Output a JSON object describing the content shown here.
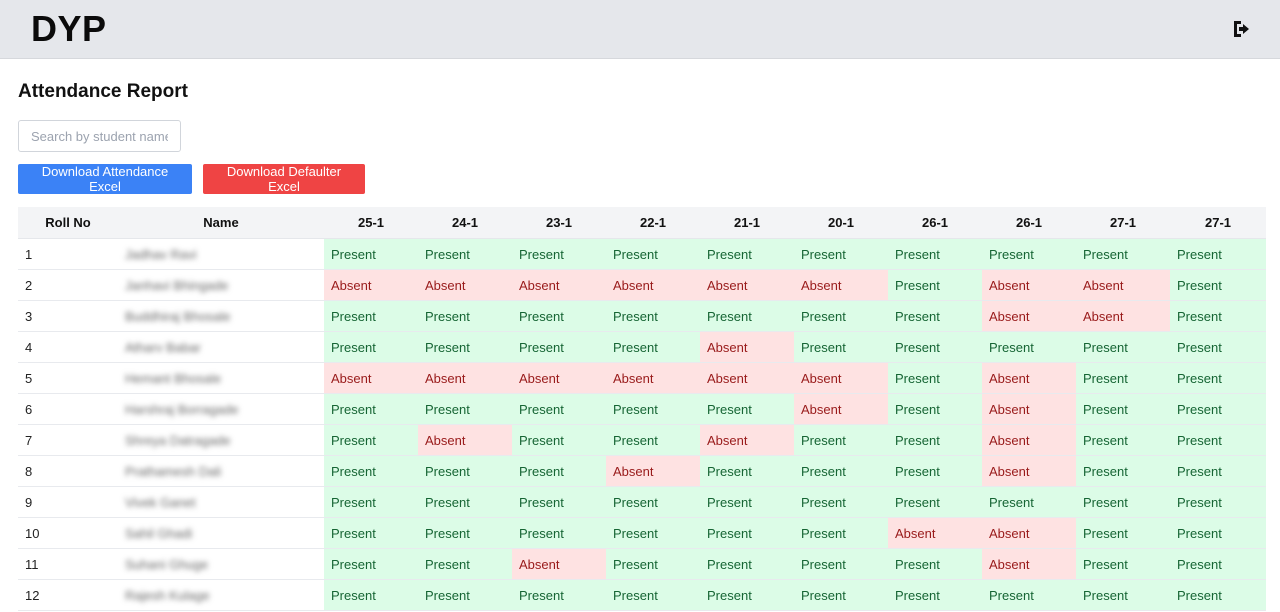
{
  "header": {
    "brand": "DYP",
    "logout_icon": "sign-out-icon"
  },
  "page": {
    "title": "Attendance Report",
    "search_placeholder": "Search by student name",
    "download_attendance_label": "Download Attendance Excel",
    "download_defaulter_label": "Download Defaulter Excel"
  },
  "colors": {
    "primary_button": "#3b82f6",
    "danger_button": "#ef4444",
    "present_bg": "#dcfce7",
    "absent_bg": "#fee2e2"
  },
  "table": {
    "headers": [
      "Roll No",
      "Name",
      "25-1",
      "24-1",
      "23-1",
      "22-1",
      "21-1",
      "20-1",
      "26-1",
      "26-1",
      "27-1",
      "27-1"
    ],
    "rows": [
      {
        "roll": "1",
        "name": "Jadhav Ravi",
        "status": [
          "Present",
          "Present",
          "Present",
          "Present",
          "Present",
          "Present",
          "Present",
          "Present",
          "Present",
          "Present"
        ]
      },
      {
        "roll": "2",
        "name": "Janhavi Bhingade",
        "status": [
          "Absent",
          "Absent",
          "Absent",
          "Absent",
          "Absent",
          "Absent",
          "Present",
          "Absent",
          "Absent",
          "Present"
        ]
      },
      {
        "roll": "3",
        "name": "Buddhiraj Bhosale",
        "status": [
          "Present",
          "Present",
          "Present",
          "Present",
          "Present",
          "Present",
          "Present",
          "Absent",
          "Absent",
          "Present"
        ]
      },
      {
        "roll": "4",
        "name": "Atharv Babar",
        "status": [
          "Present",
          "Present",
          "Present",
          "Present",
          "Absent",
          "Present",
          "Present",
          "Present",
          "Present",
          "Present"
        ]
      },
      {
        "roll": "5",
        "name": "Hemant Bhosale",
        "status": [
          "Absent",
          "Absent",
          "Absent",
          "Absent",
          "Absent",
          "Absent",
          "Present",
          "Absent",
          "Present",
          "Present"
        ]
      },
      {
        "roll": "6",
        "name": "Harshraj Borragade",
        "status": [
          "Present",
          "Present",
          "Present",
          "Present",
          "Present",
          "Absent",
          "Present",
          "Absent",
          "Present",
          "Present"
        ]
      },
      {
        "roll": "7",
        "name": "Shreya Datragade",
        "status": [
          "Present",
          "Absent",
          "Present",
          "Present",
          "Absent",
          "Present",
          "Present",
          "Absent",
          "Present",
          "Present"
        ]
      },
      {
        "roll": "8",
        "name": "Prathamesh Dali",
        "status": [
          "Present",
          "Present",
          "Present",
          "Absent",
          "Present",
          "Present",
          "Present",
          "Absent",
          "Present",
          "Present"
        ]
      },
      {
        "roll": "9",
        "name": "Vivek Ganet",
        "status": [
          "Present",
          "Present",
          "Present",
          "Present",
          "Present",
          "Present",
          "Present",
          "Present",
          "Present",
          "Present"
        ]
      },
      {
        "roll": "10",
        "name": "Sahil Ghadi",
        "status": [
          "Present",
          "Present",
          "Present",
          "Present",
          "Present",
          "Present",
          "Absent",
          "Absent",
          "Present",
          "Present"
        ]
      },
      {
        "roll": "11",
        "name": "Suhani Ghuge",
        "status": [
          "Present",
          "Present",
          "Absent",
          "Present",
          "Present",
          "Present",
          "Present",
          "Absent",
          "Present",
          "Present"
        ]
      },
      {
        "roll": "12",
        "name": "Rajesh Kulage",
        "status": [
          "Present",
          "Present",
          "Present",
          "Present",
          "Present",
          "Present",
          "Present",
          "Present",
          "Present",
          "Present"
        ]
      }
    ]
  }
}
